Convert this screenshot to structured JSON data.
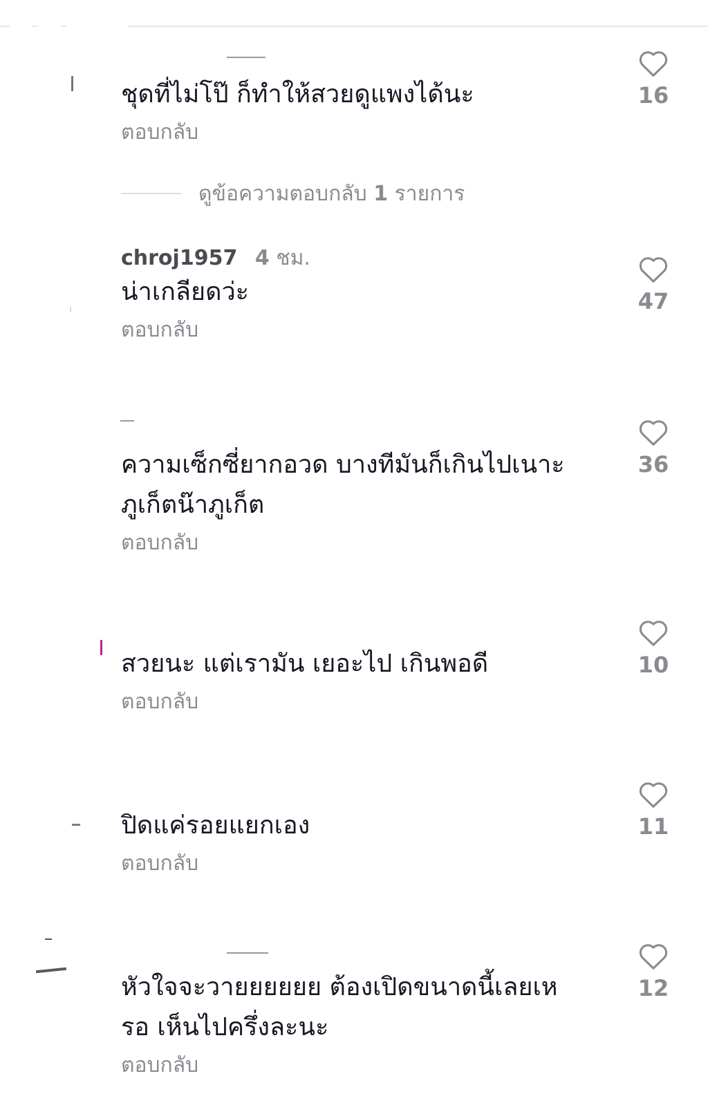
{
  "comments": [
    {
      "username": "",
      "time_value": "",
      "time_unit": "",
      "text_lines": [
        "ชุดที่ไม่โป๊ ก็ทำให้สวยดูแพงได้นะ"
      ],
      "reply_label": "ตอบกลับ",
      "likes": "16"
    },
    {
      "username": "chroj1957",
      "time_value": "4",
      "time_unit": "ชม.",
      "text_lines": [
        "น่าเกลียดว่ะ"
      ],
      "reply_label": "ตอบกลับ",
      "likes": "47"
    },
    {
      "username": "",
      "time_value": "",
      "time_unit": "",
      "text_lines": [
        "ความเซ็กซี่ยากอวด บางทีมันก็เกินไปเนาะ",
        "ภูเก็ตน๊าภูเก็ต"
      ],
      "reply_label": "ตอบกลับ",
      "likes": "36"
    },
    {
      "username": "",
      "time_value": "",
      "time_unit": "",
      "text_lines": [
        "สวยนะ แต่เรามัน เยอะไป เกินพอดี"
      ],
      "reply_label": "ตอบกลับ",
      "likes": "10"
    },
    {
      "username": "",
      "time_value": "",
      "time_unit": "",
      "text_lines": [
        "ปิดแค่รอยแยกเอง"
      ],
      "reply_label": "ตอบกลับ",
      "likes": "11"
    },
    {
      "username": "",
      "time_value": "",
      "time_unit": "",
      "text_lines": [
        "หัวใจจะวายยยยยย ต้องเปิดขนาดนี้เลยเห",
        "รอ เห็นไปครึ่งละนะ"
      ],
      "reply_label": "ตอบกลับ",
      "likes": "12"
    }
  ],
  "view_replies": {
    "label": "ดูข้อความตอบกลับ",
    "count": "1",
    "suffix": "รายการ"
  },
  "icons": {
    "like": "heart-outline-icon"
  },
  "colors": {
    "text_primary": "#161823",
    "text_secondary": "#8a8b91",
    "username": "#4a4b52",
    "icon": "#8a8b91",
    "divider": "#e6e6e6"
  }
}
